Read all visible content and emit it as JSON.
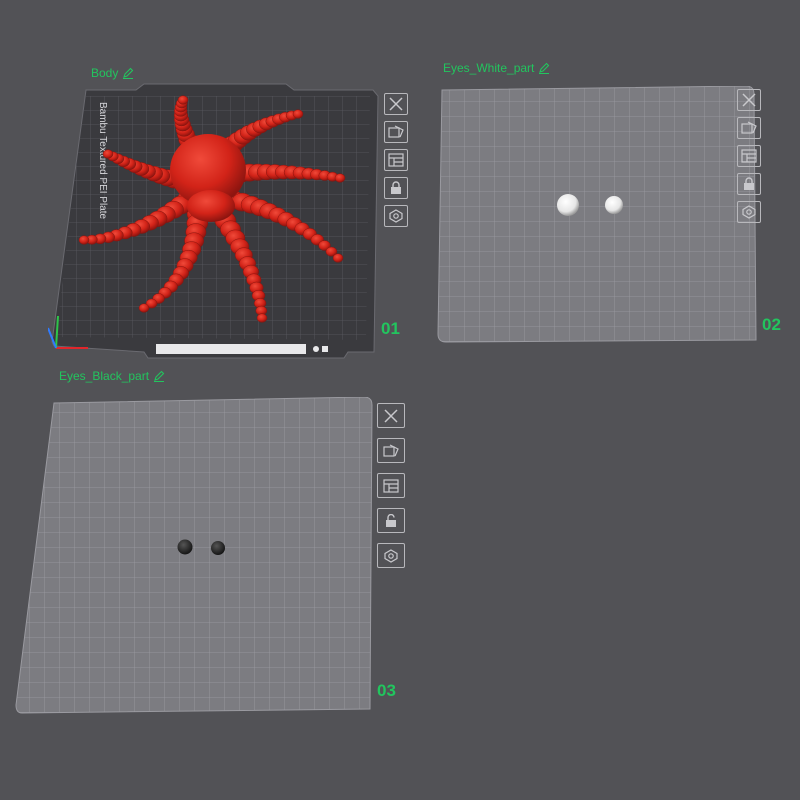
{
  "plates": [
    {
      "name": "Body",
      "number": "01",
      "bed_label": "Bambu Textured PEI Plate",
      "part_color": "#d7261b",
      "toolbar": [
        "close-icon",
        "auto-orient-icon",
        "arrange-icon",
        "lock-icon",
        "settings-icon"
      ]
    },
    {
      "name": "Eyes_White_part",
      "number": "02",
      "part_color": "#f2f2f2",
      "toolbar": [
        "close-icon",
        "auto-orient-icon",
        "arrange-icon",
        "lock-icon",
        "settings-icon"
      ]
    },
    {
      "name": "Eyes_Black_part",
      "number": "03",
      "part_color": "#2a2a2a",
      "toolbar": [
        "close-icon",
        "auto-orient-icon",
        "arrange-icon",
        "unlock-icon",
        "settings-icon"
      ]
    }
  ],
  "colors": {
    "background": "#525256",
    "label_green": "#22c55e",
    "plate_fill": "#7b7b80",
    "grid_line": "#9a9aa0",
    "build_plate": "#3a3a3e"
  }
}
